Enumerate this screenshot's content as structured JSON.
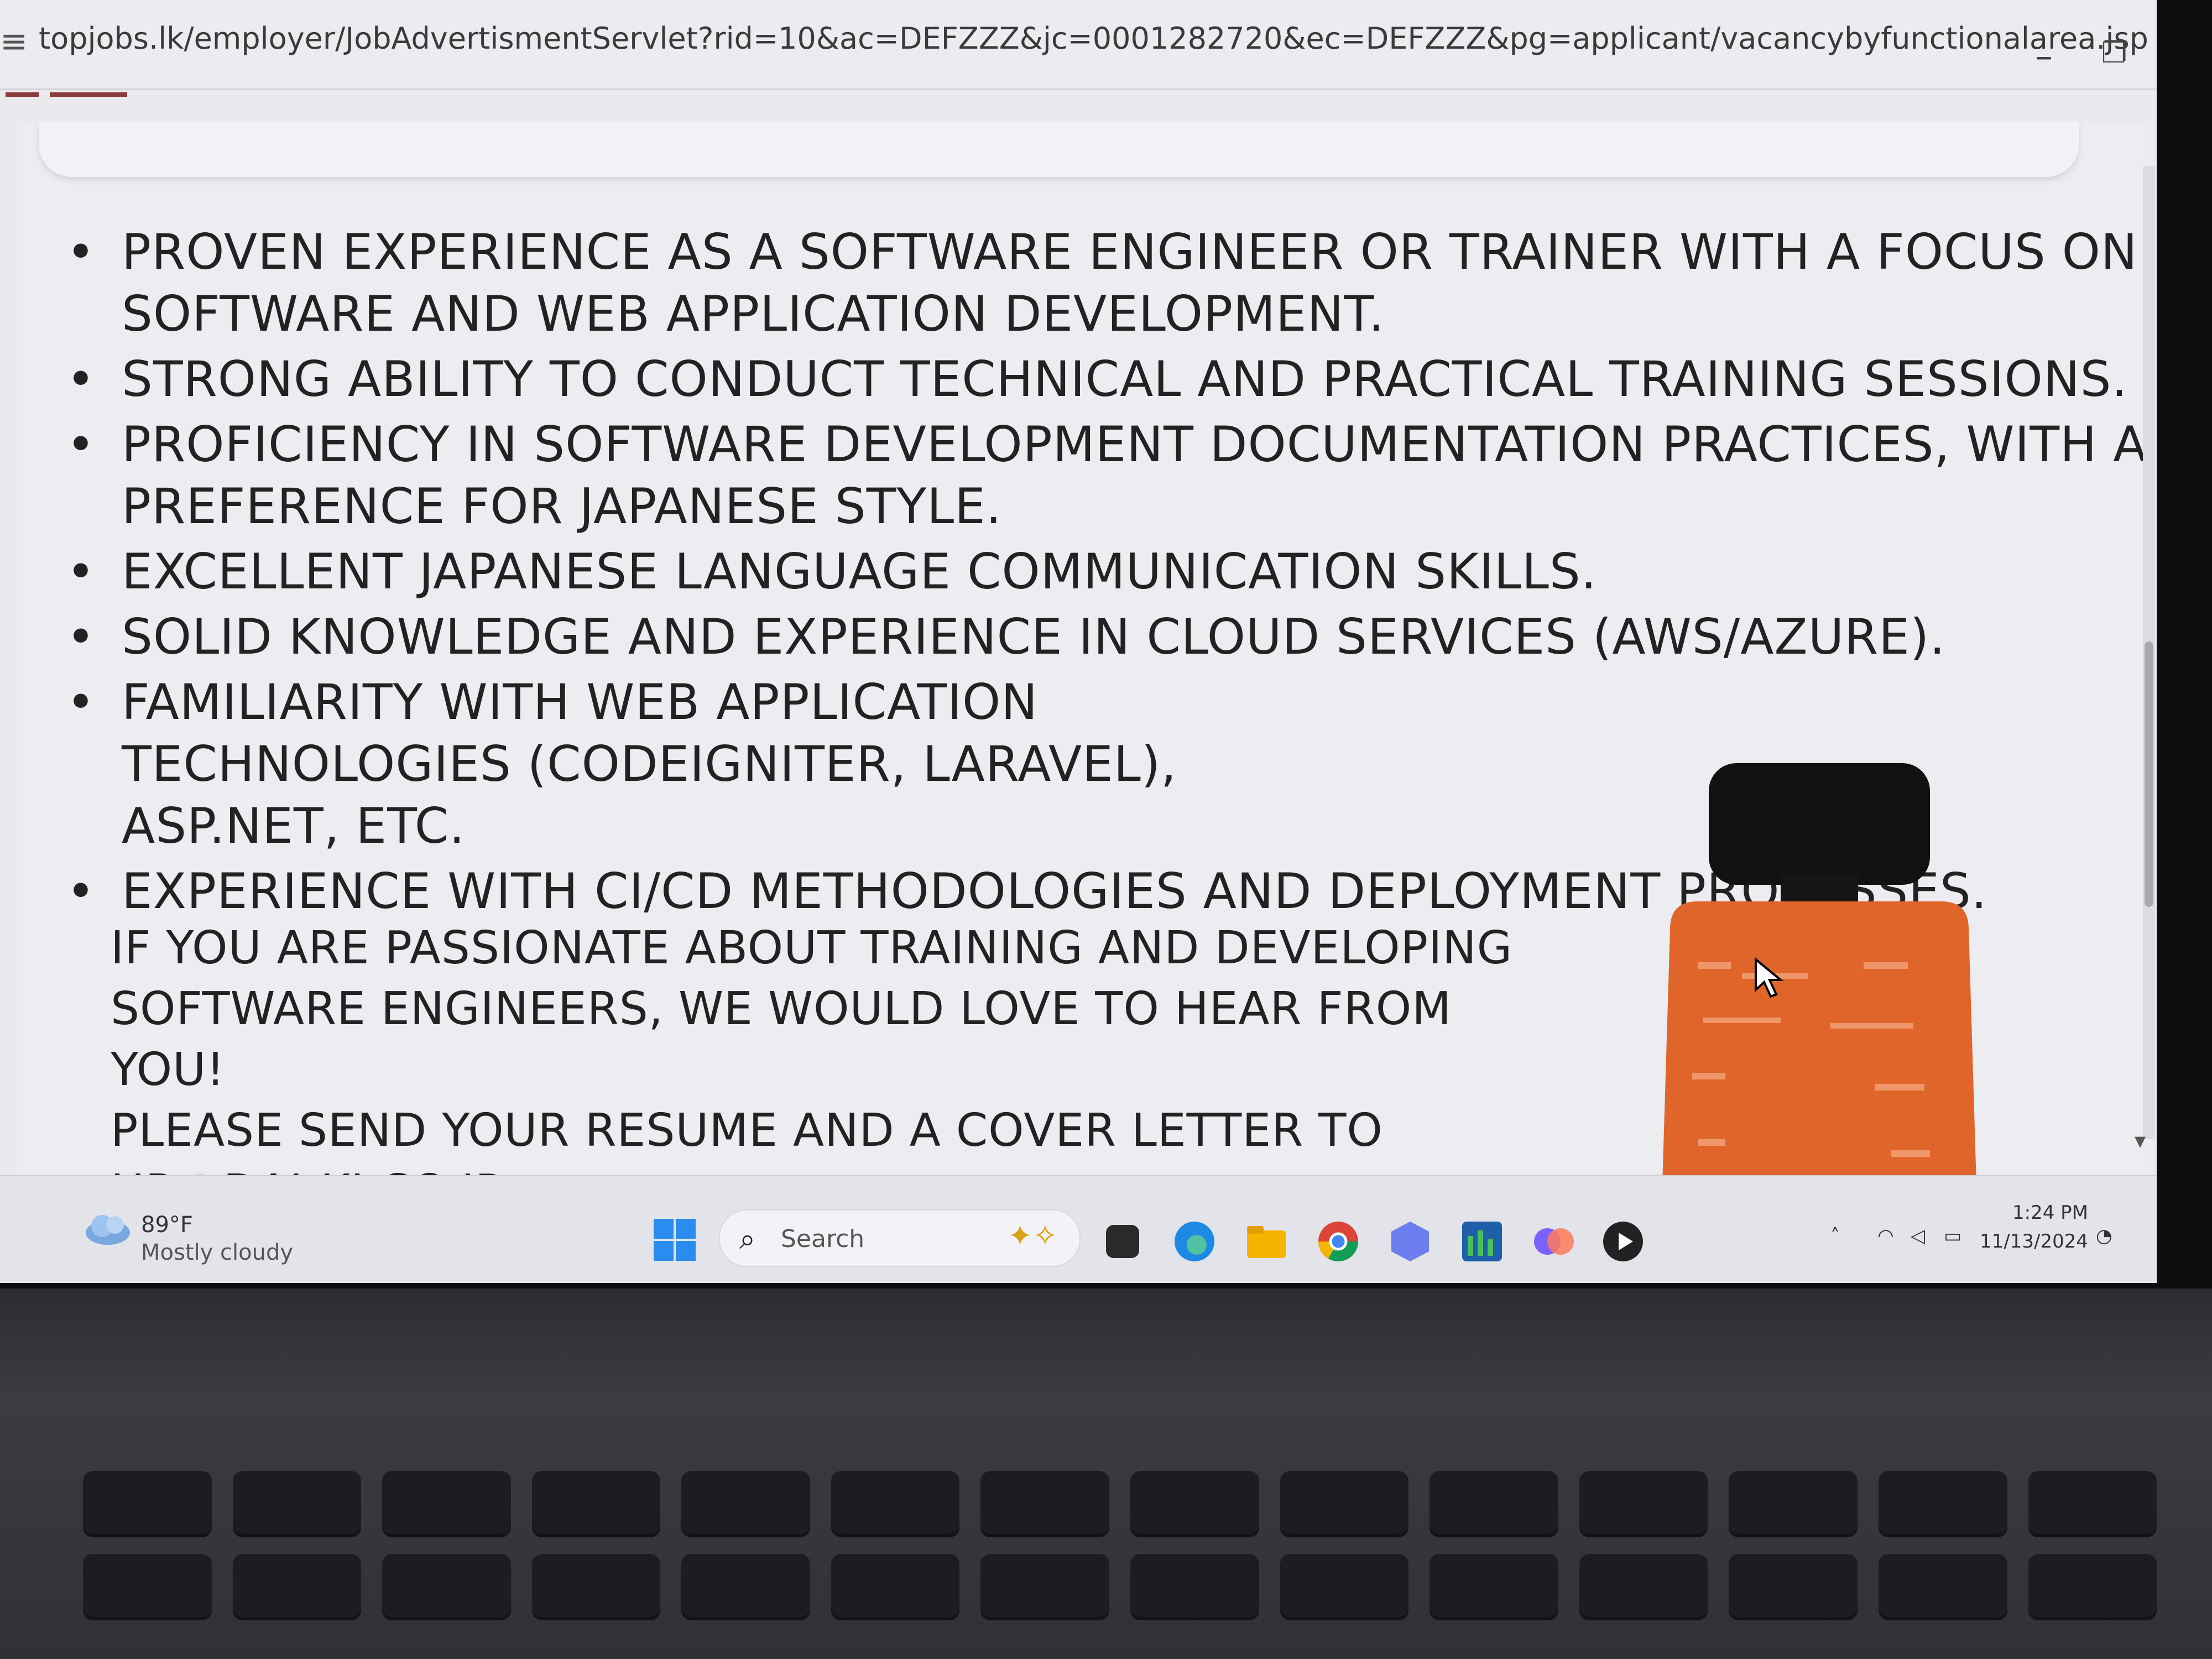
{
  "browser": {
    "url": "topjobs.lk/employer/JobAdvertismentServlet?rid=10&ac=DEFZZZ&jc=0001282720&ec=DEFZZZ&pg=applicant/vacancybyfunctionalarea.jsp",
    "minimize": "–",
    "restore": "❐",
    "close": "✕",
    "zoom_icon": "⌕"
  },
  "requirements": [
    "PROVEN EXPERIENCE AS A SOFTWARE ENGINEER OR TRAINER WITH A FOCUS ON SOFTWARE AND WEB APPLICATION DEVELOPMENT.",
    "STRONG ABILITY TO CONDUCT TECHNICAL AND PRACTICAL TRAINING SESSIONS.",
    "PROFICIENCY IN SOFTWARE DEVELOPMENT DOCUMENTATION PRACTICES, WITH A PREFERENCE FOR JAPANESE STYLE.",
    "EXCELLENT JAPANESE LANGUAGE COMMUNICATION SKILLS.",
    "SOLID KNOWLEDGE AND EXPERIENCE IN CLOUD SERVICES (AWS/AZURE).",
    "FAMILIARITY WITH WEB APPLICATION TECHNOLOGIES (CODEIGNITER, LARAVEL), ASP.NET, ETC.",
    "EXPERIENCE WITH CI/CD METHODOLOGIES AND DEPLOYMENT PROCESSES."
  ],
  "closing": {
    "line1": "IF YOU ARE PASSIONATE ABOUT TRAINING AND DEVELOPING",
    "line2": "SOFTWARE ENGINEERS, WE WOULD LOVE TO HEAR FROM YOU!",
    "line3": "PLEASE SEND YOUR RESUME AND A COVER LETTER TO",
    "email": "HR@DAI-KI.CO.JP"
  },
  "taskbar": {
    "weather_temp": "89°F",
    "weather_desc": "Mostly cloudy",
    "search_placeholder": "Search",
    "time": "1:24 PM",
    "date": "11/13/2024",
    "colors": {
      "edge": "#1e88e5",
      "explorer": "#f4b400",
      "chrome_red": "#db4437",
      "chrome_green": "#0f9d58",
      "copilot": "#7b61ff"
    }
  }
}
